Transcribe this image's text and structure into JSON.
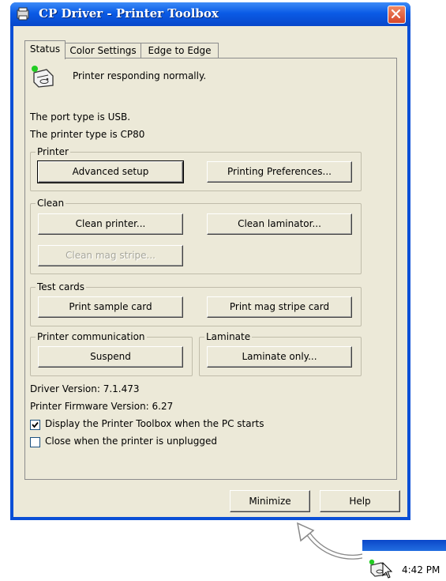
{
  "window": {
    "title": "CP Driver - Printer Toolbox",
    "accent": "#0a4fd6"
  },
  "tabs": [
    {
      "label": "Status",
      "active": true
    },
    {
      "label": "Color Settings",
      "active": false
    },
    {
      "label": "Edge to Edge",
      "active": false
    }
  ],
  "status": {
    "message": "Printer responding normally.",
    "port_type": "The port type is USB.",
    "printer_type": "The printer type is CP80",
    "indicator_color": "#22cc22"
  },
  "groups": {
    "printer": {
      "legend": "Printer",
      "advanced_setup": "Advanced setup",
      "printing_preferences": "Printing Preferences..."
    },
    "clean": {
      "legend": "Clean",
      "clean_printer": "Clean printer...",
      "clean_laminator": "Clean laminator...",
      "clean_mag_stripe": "Clean mag stripe..."
    },
    "test_cards": {
      "legend": "Test cards",
      "print_sample": "Print sample card",
      "print_mag_stripe": "Print mag stripe card"
    },
    "communication": {
      "legend": "Printer communication",
      "suspend": "Suspend"
    },
    "laminate": {
      "legend": "Laminate",
      "laminate_only": "Laminate only..."
    }
  },
  "versions": {
    "driver": "Driver Version: 7.1.473",
    "firmware": "Printer Firmware Version: 6.27"
  },
  "options": {
    "display_on_start": {
      "label": "Display the Printer Toolbox when the PC starts",
      "checked": true
    },
    "close_when_unplugged": {
      "label": "Close when the printer is unplugged",
      "checked": false
    }
  },
  "footer": {
    "minimize": "Minimize",
    "help": "Help"
  },
  "taskbar": {
    "time": "4:42 PM"
  }
}
